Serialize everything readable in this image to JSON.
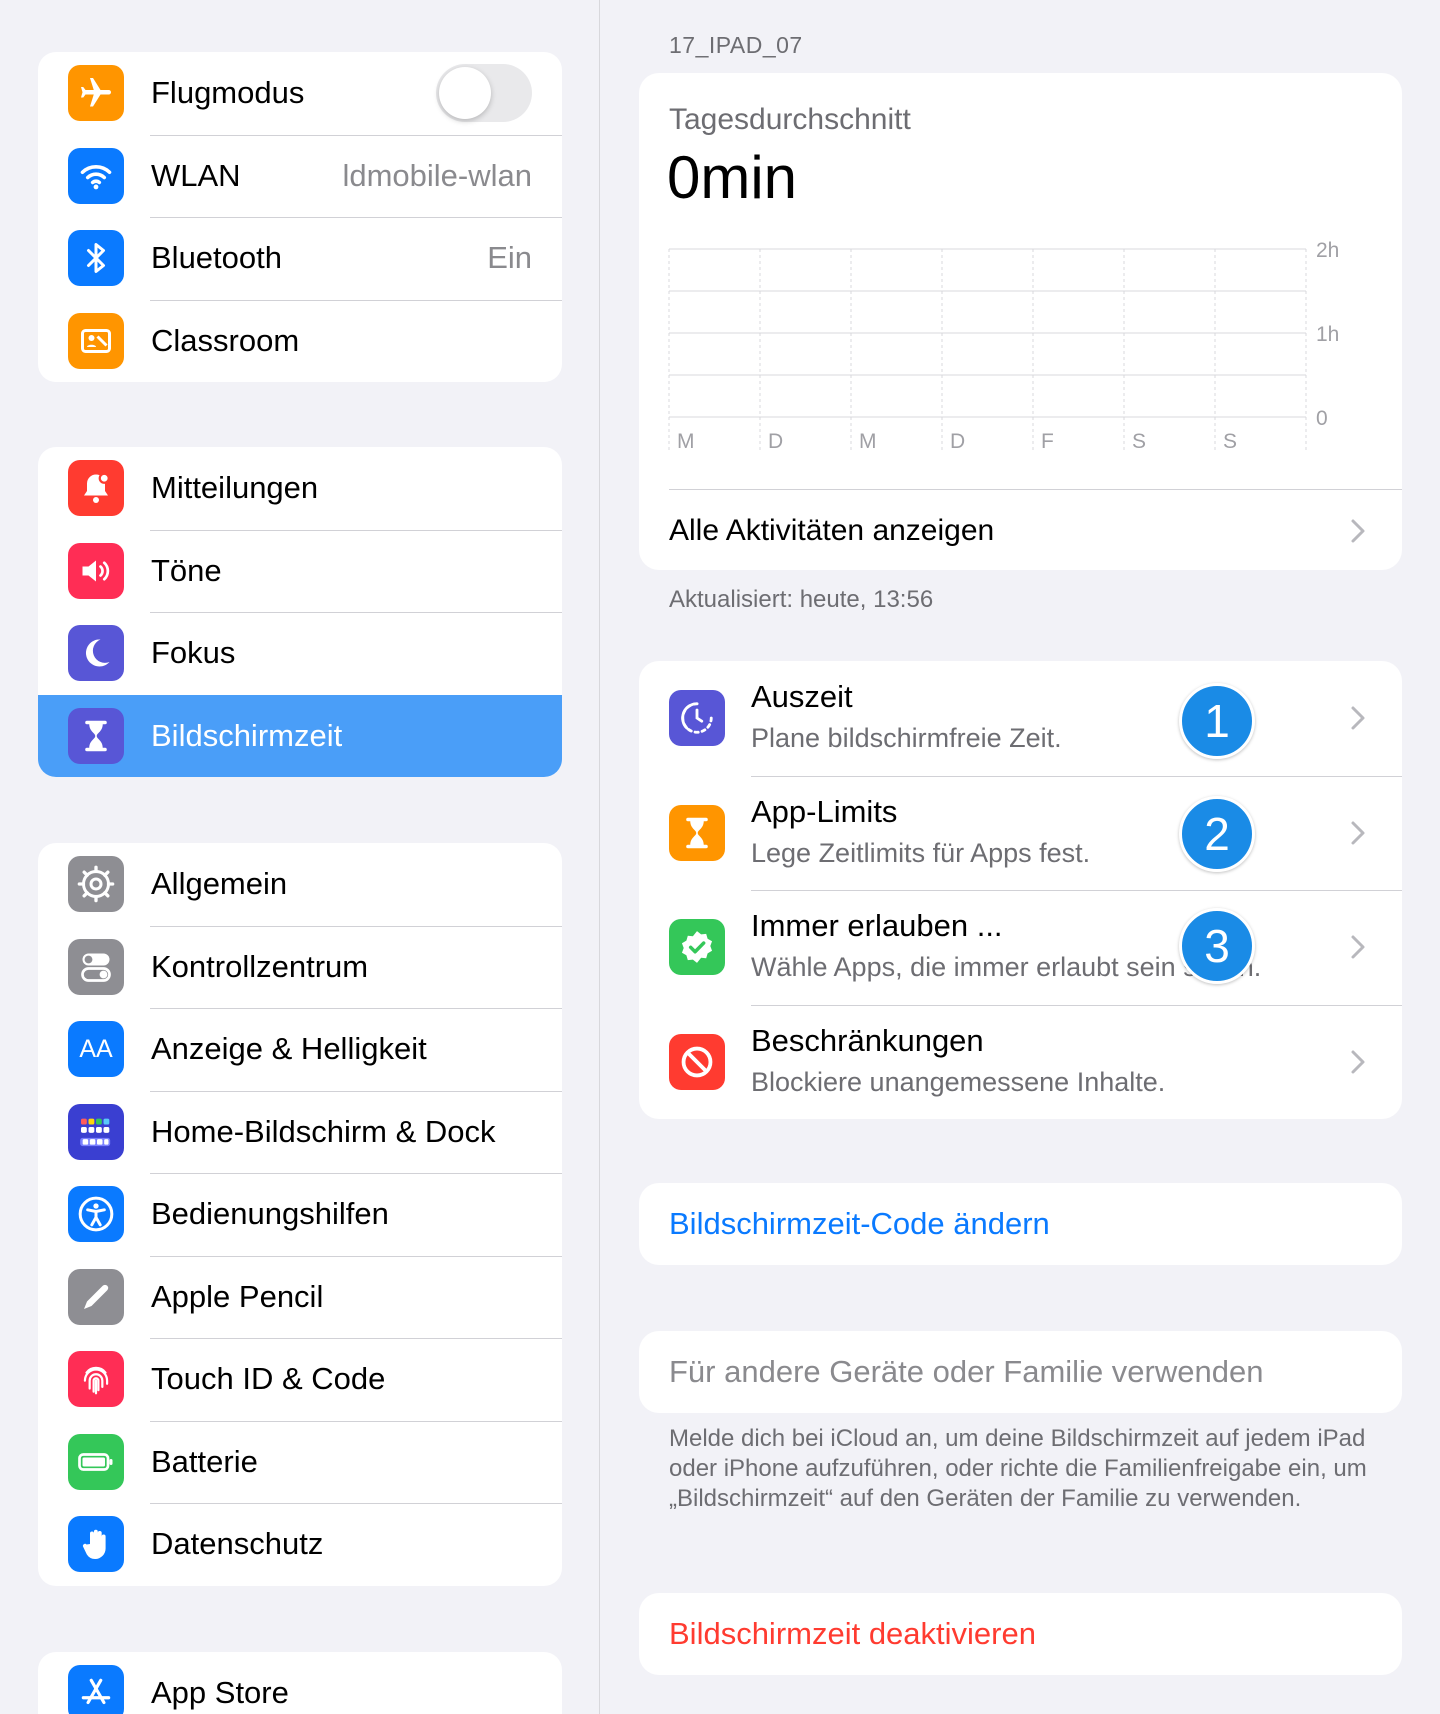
{
  "colors": {
    "selected_row": "#4a9ef8",
    "link_blue": "#0a7aff",
    "destructive_red": "#ff3b30",
    "badge_blue": "#1a8be6"
  },
  "sidebar": {
    "group1": [
      {
        "label": "Flugmodus",
        "icon": "airplane-icon",
        "color": "#ff9500",
        "toggle": false
      },
      {
        "label": "WLAN",
        "value": "ldmobile-wlan",
        "icon": "wifi-icon",
        "color": "#0a7aff"
      },
      {
        "label": "Bluetooth",
        "value": "Ein",
        "icon": "bluetooth-icon",
        "color": "#0a7aff"
      },
      {
        "label": "Classroom",
        "icon": "classroom-icon",
        "color": "#ff9500"
      }
    ],
    "group2": [
      {
        "label": "Mitteilungen",
        "icon": "notifications-bell-icon",
        "color": "#ff3b30"
      },
      {
        "label": "Töne",
        "icon": "speaker-icon",
        "color": "#ff2d55"
      },
      {
        "label": "Fokus",
        "icon": "moon-icon",
        "color": "#5856d6"
      },
      {
        "label": "Bildschirmzeit",
        "icon": "hourglass-icon",
        "color": "#5856d6",
        "selected": true
      }
    ],
    "group3": [
      {
        "label": "Allgemein",
        "icon": "gear-icon",
        "color": "#8e8e93"
      },
      {
        "label": "Kontrollzentrum",
        "icon": "switches-icon",
        "color": "#8e8e93"
      },
      {
        "label": "Anzeige & Helligkeit",
        "icon": "text-size-icon",
        "icon_text": "AA",
        "color": "#0a7aff"
      },
      {
        "label": "Home-Bildschirm & Dock",
        "icon": "app-grid-icon",
        "color": "#3a3fd1"
      },
      {
        "label": "Bedienungshilfen",
        "icon": "accessibility-icon",
        "color": "#0a7aff"
      },
      {
        "label": "Apple Pencil",
        "icon": "pencil-icon",
        "color": "#8e8e93"
      },
      {
        "label": "Touch ID & Code",
        "icon": "fingerprint-icon",
        "color": "#ff2d55"
      },
      {
        "label": "Batterie",
        "icon": "battery-icon",
        "color": "#34c759"
      },
      {
        "label": "Datenschutz",
        "icon": "hand-icon",
        "color": "#0a7aff"
      }
    ],
    "group4": [
      {
        "label": "App Store",
        "icon": "app-store-icon",
        "color": "#0a7aff"
      }
    ]
  },
  "main": {
    "device_label": "17_IPAD_07",
    "chart_card": {
      "subtitle": "Tagesdurchschnitt",
      "value": "0min",
      "link_label": "Alle Aktivitäten anzeigen"
    },
    "updated": "Aktualisiert: heute, 13:56",
    "options": [
      {
        "title": "Auszeit",
        "subtitle": "Plane bildschirmfreie Zeit.",
        "icon": "downtime-icon",
        "color": "#5856d6",
        "badge": "1"
      },
      {
        "title": "App-Limits",
        "subtitle": "Lege Zeitlimits für Apps fest.",
        "icon": "hourglass-icon",
        "color": "#ff9500",
        "badge": "2"
      },
      {
        "title": "Immer erlauben ...",
        "subtitle": "Wähle Apps, die immer erlaubt sein sollen.",
        "icon": "checkmark-seal-icon",
        "color": "#34c759",
        "badge": "3"
      },
      {
        "title": "Beschränkungen",
        "subtitle": "Blockiere unangemessene Inhalte.",
        "icon": "restriction-icon",
        "color": "#ff3b30"
      }
    ],
    "change_code": "Bildschirmzeit-Code ändern",
    "family": "Für andere Geräte oder Familie verwenden",
    "footnote": "Melde dich bei iCloud an, um deine Bildschirmzeit auf jedem iPad oder iPhone aufzuführen, oder richte die Familienfreigabe ein, um „Bildschirmzeit“ auf den Geräten der Familie zu verwenden.",
    "deactivate": "Bildschirmzeit deaktivieren"
  },
  "chart_data": {
    "type": "bar",
    "categories": [
      "M",
      "D",
      "M",
      "D",
      "F",
      "S",
      "S"
    ],
    "values": [
      0,
      0,
      0,
      0,
      0,
      0,
      0
    ],
    "y_ticks": [
      "2h",
      "1h",
      "0"
    ],
    "ylim": [
      0,
      2
    ],
    "grid": true
  }
}
